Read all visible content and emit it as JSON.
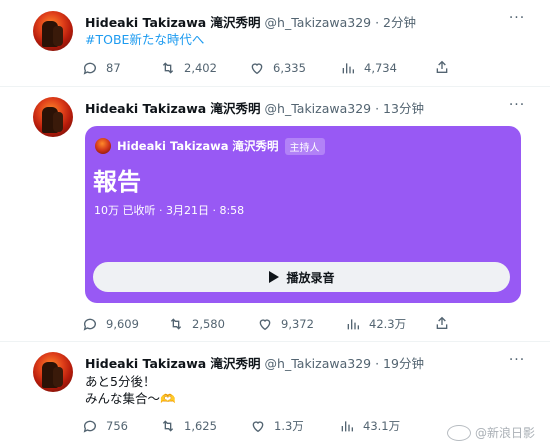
{
  "accent": "#1d9bf0",
  "space_color": "#9859f4",
  "tweets": [
    {
      "name": "Hideaki Takizawa 滝沢秀明",
      "handle": "@h_Takizawa329 · 2分钟",
      "text_line1": "#TOBE新たな時代へ",
      "replies": "87",
      "retweets": "2,402",
      "likes": "6,335",
      "views": "4,734"
    },
    {
      "name": "Hideaki Takizawa 滝沢秀明",
      "handle": "@h_Takizawa329 · 13分钟",
      "space": {
        "host_name": "Hideaki Takizawa 滝沢秀明",
        "host_badge": "主持人",
        "title": "報告",
        "meta": "10万 已收听 · 3月21日 · 8:58",
        "play_label": "播放录音"
      },
      "replies": "9,609",
      "retweets": "2,580",
      "likes": "9,372",
      "views": "42.3万"
    },
    {
      "name": "Hideaki Takizawa 滝沢秀明",
      "handle": "@h_Takizawa329 · 19分钟",
      "text_line1": "あと5分後！",
      "text_line2": "みんな集合〜🫶",
      "replies": "756",
      "retweets": "1,625",
      "likes": "1.3万",
      "views": "43.1万"
    }
  ],
  "more_glyph": "···",
  "watermark": "@新浪日影"
}
